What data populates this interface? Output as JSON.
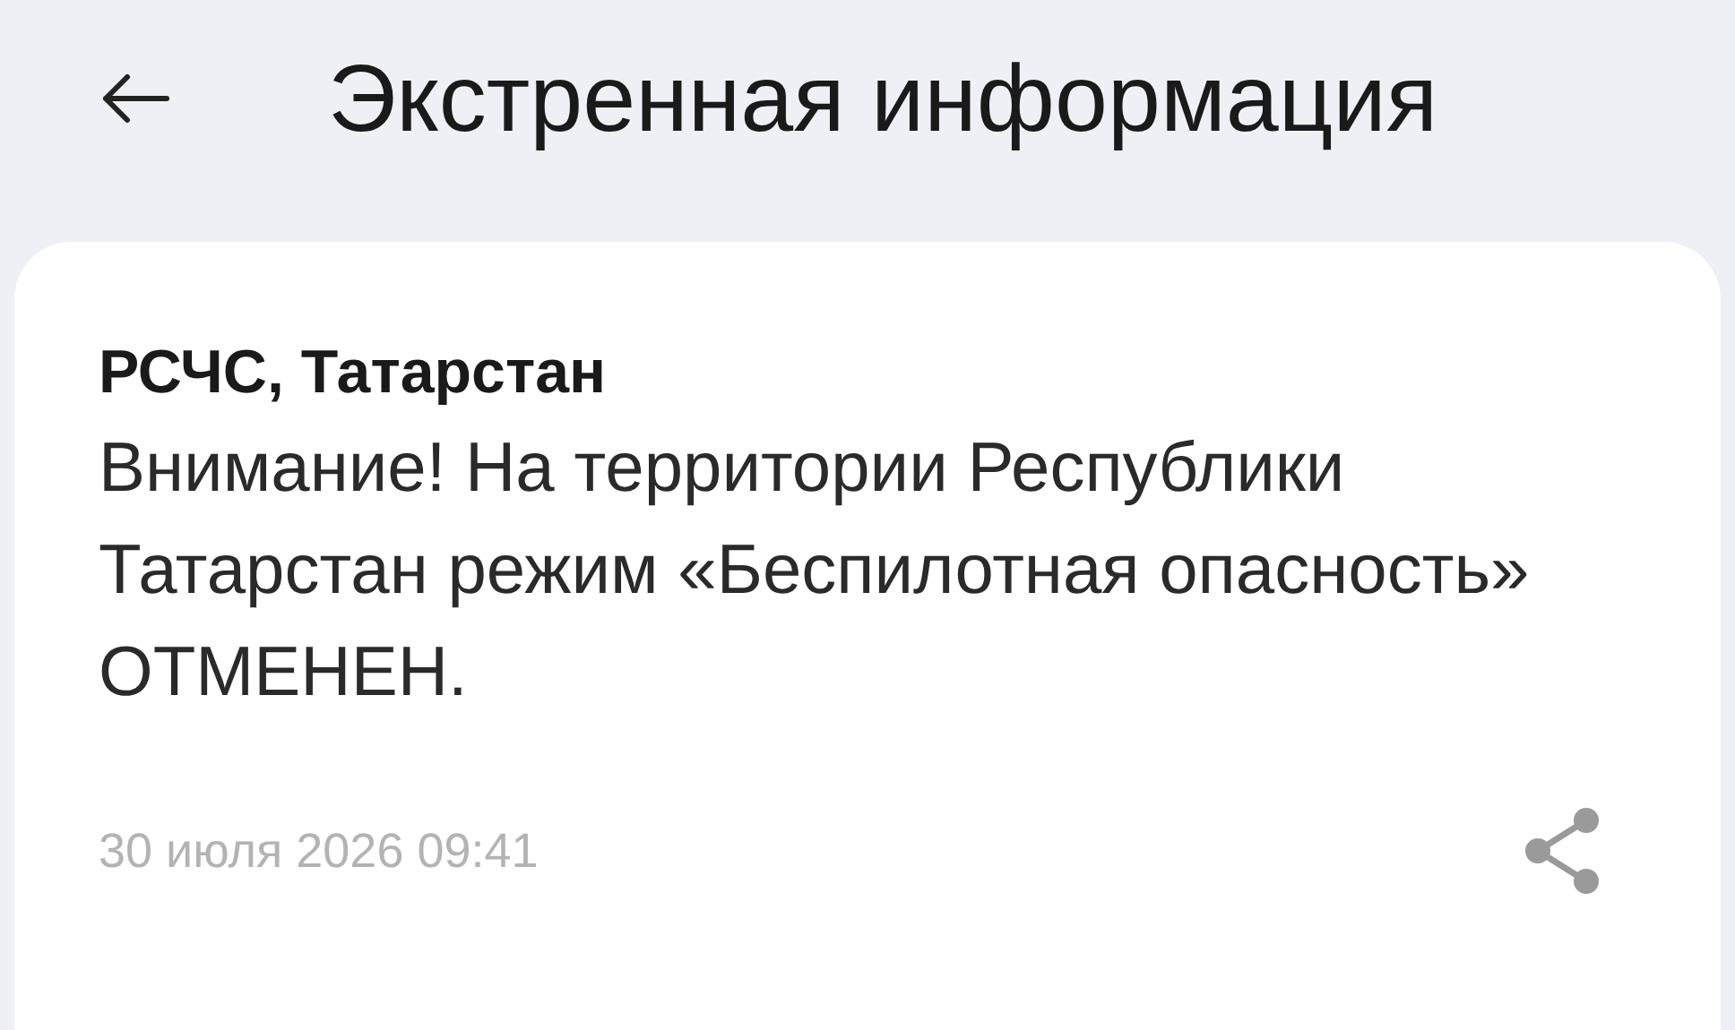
{
  "header": {
    "title": "Экстренная информация"
  },
  "message": {
    "sender": "РСЧС, Татарстан",
    "text": "Внимание! На территории Республики Татарстан режим «Беспилотная опасность» ОТМЕНЕН.",
    "timestamp": "30 июля 2026 09:41"
  }
}
